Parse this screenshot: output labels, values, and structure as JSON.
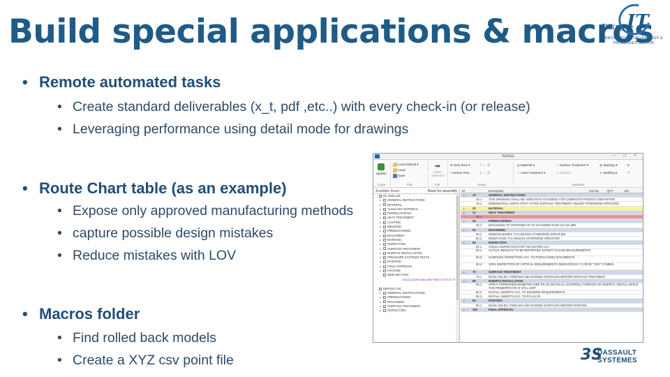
{
  "slide": {
    "title": "Build special applications & macros",
    "logo": {
      "doing": "Doing",
      "it": "IT",
      "line1": "INFORMATION TECHNOLOGY &",
      "line2": "PROCESSES SECTOR"
    },
    "brand": {
      "line1": "DASSAULT",
      "line2": "SYSTEMES"
    },
    "bullets": [
      {
        "text": "Remote automated tasks",
        "sub": [
          "Create standard deliverables (x_t, pdf ,etc..) with every check-in (or release)",
          "Leveraging performance using detail mode for drawings"
        ]
      },
      {
        "text": "Route Chart table (as an example)",
        "sub": [
          "Expose only approved manufacturing methods",
          "capture possible design mistakes",
          "Reduce mistakes with LOV"
        ]
      },
      {
        "text": "Macros folder",
        "sub": [
          "Find rolled back models",
          "Create a XYZ csv point file"
        ]
      }
    ]
  },
  "app": {
    "window_title": "RoData",
    "controls": "– □ ×",
    "ribbon": {
      "update": "Update",
      "load_default": "Load Default",
      "load": "Load",
      "save": "Save",
      "insert_selected": "Insert Selected",
      "new_row": "New Row",
      "delete_row": "Delete Row",
      "material": "Material",
      "heat_treatment": "Heat Treatment",
      "surface_treatment": "Surface Treatment",
      "symbol": "Symbol",
      "marking": "Marking",
      "welding": "Welding",
      "groups": [
        "Login",
        "File",
        "List",
        "Rows",
        "Modules"
      ]
    },
    "left_pane": {
      "header_left": "Available Rows",
      "header_right": "Rows for assembly",
      "items": [
        "RC Data List",
        "GENERAL INSTRUCTIONS",
        "MATERIAL",
        "AUXILIARY MATERIAL",
        "PAPRES PARTS1",
        "HEAT TREATMENT",
        "CASTING",
        "WELDING",
        "PREMACHINING",
        "MACHINING",
        "MARKING",
        "INSPECTION",
        "SURFACE TREATMENT",
        "INSERTS INSTALLATION",
        "PRESSURE SYSTEMS TESTS",
        "PAINTING",
        "FINAL APPROVAL",
        "PACKING",
        "NEW SECTION"
      ],
      "hebrew_item": "שורת הוראות חרושתי שאין שם פתקים בטבלה",
      "items2": [
        "DEFAULT RC",
        "GENERAL INSTRUCTIONS",
        "PREMACHINING",
        "MACHINING",
        "SURFACE TREATMENT",
        "INSPECTION"
      ]
    },
    "grid": {
      "headers": {
        "id": "ID",
        "desc": "Description",
        "cat": "Cat No.",
        "qty": "QTY",
        "um": "UM"
      },
      "rows": [
        {
          "kind": "section",
          "id": "10",
          "desc": "GENERAL INSTRUCTIONS"
        },
        {
          "kind": "sub",
          "id": "10.1",
          "desc": "THIS DRAWING SHALL BE USED WITH ITS MODEL FOR COMPLETE PRODUCT DEFINITION"
        },
        {
          "kind": "sub",
          "id": "10.2",
          "desc": "DIMENSIONAL LIMITS APPLY AFTER SURFACE TREATMENT UNLESS OTHERWISE SPECIFIED"
        },
        {
          "kind": "yellow",
          "id": "20",
          "desc": "MATERIAL"
        },
        {
          "kind": "section",
          "id": "30",
          "desc": "HEAT TREATMENT"
        },
        {
          "kind": "red",
          "id": "30.1",
          "desc": ""
        },
        {
          "kind": "section",
          "id": "40",
          "desc": "PREMACHINING"
        },
        {
          "kind": "sub",
          "id": "40.1",
          "desc": "MACHINING TO OVERSIZE OF XX mm  INNER RADII XX mm MIN"
        },
        {
          "kind": "section",
          "id": "50",
          "desc": "MACHINING"
        },
        {
          "kind": "sub",
          "id": "50.1",
          "desc": "REMOVE BURRS ^0.3  UNLESS OTHERWISE SPECIFIED"
        },
        {
          "kind": "sub",
          "id": "50.2",
          "desc": "INNER RADII ^0.3  UNLESS OTHERWISE SPECIFIED"
        },
        {
          "kind": "section",
          "id": "60",
          "desc": "INSPECTION"
        },
        {
          "kind": "sub",
          "id": "60.1",
          "desc": "VISUAL INSPECTION FOR THE ENTIRE LOT"
        },
        {
          "kind": "subtall",
          "id": "60.2",
          "desc": "ACTUAL RESULTS TO BE REPORTED, EXCEPT GAUGE MEASUREMENTS"
        },
        {
          "kind": "subtall",
          "id": "60.3",
          "desc": "SAMPLING INSPECTION ACC. TO PURCHASING DOCUMENTS"
        },
        {
          "kind": "subtall",
          "id": "60.4",
          "desc": "100% INSPECTION OF CRITICAL REQUIREMENTS INDICATED BY (*) OR BY \"KEY\" SYMBOL"
        },
        {
          "kind": "section",
          "id": "70",
          "desc": "SURFACE TREATMENT"
        },
        {
          "kind": "sub",
          "id": "70.1",
          "desc": "MASK HOLES, THREADS AND MARKED SURFACES BEFORE SURFACE TREATMENT"
        },
        {
          "kind": "section",
          "id": "80",
          "desc": "INSERTS INSTALLATION"
        },
        {
          "kind": "subtall",
          "id": "80.1",
          "desc": "APPLY CORROSION INHIBITOR (SEE PS-111.29) ON ALL EXTERNAL THREADS OF INSERTS, INSTALL WHILE THE PRIMER/PASTE IS STILL WET"
        },
        {
          "kind": "sub",
          "id": "80.2",
          "desc": "INSTALL INSERTS ACC. TO DRAWING REQUIREMENTS"
        },
        {
          "kind": "sub",
          "id": "80.3",
          "desc": "INSTALL INSERTS ACC. TO PS-111.29"
        },
        {
          "kind": "section",
          "id": "90",
          "desc": "PAINTING"
        },
        {
          "kind": "sub",
          "id": "90.1",
          "desc": "MASK HOLES, THREADS AND MARKED SURFACES BEFORE PAINTING"
        },
        {
          "kind": "section",
          "id": "100",
          "desc": "FINAL APPROVAL"
        }
      ]
    }
  }
}
